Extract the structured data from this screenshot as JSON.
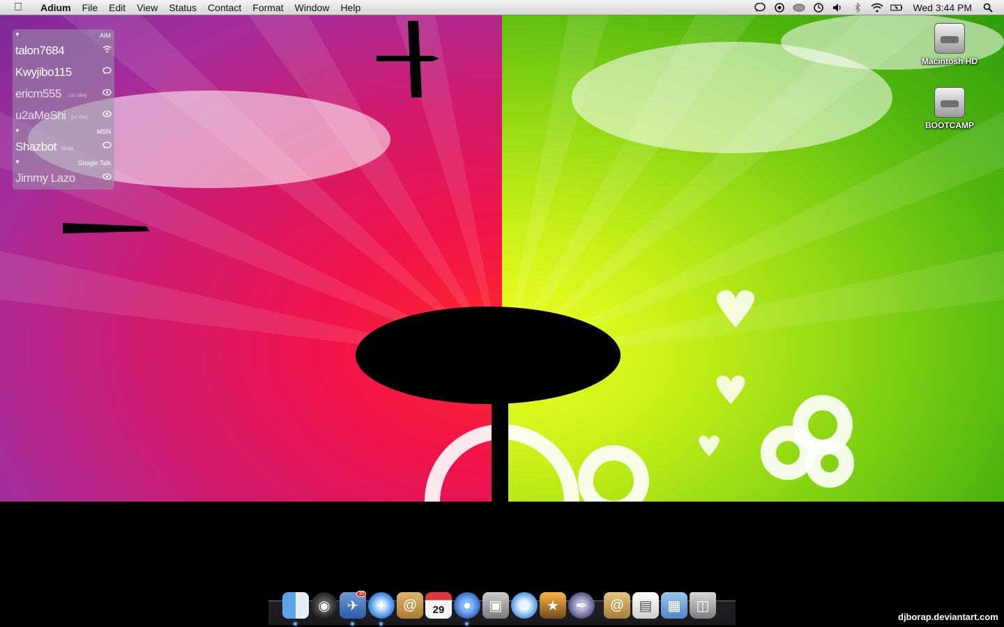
{
  "menubar": {
    "apple_icon": "apple-logo",
    "app_name": "Adium",
    "items": [
      "File",
      "Edit",
      "View",
      "Status",
      "Contact",
      "Format",
      "Window",
      "Help"
    ],
    "status_icons": [
      "adium-bubble-icon",
      "skype-icon",
      "mouse-icon",
      "time-machine-icon",
      "volume-icon",
      "bluetooth-icon",
      "wifi-icon",
      "battery-icon"
    ],
    "clock": "Wed 3:44 PM",
    "search_icon": "spotlight-icon"
  },
  "buddylist": {
    "groups": [
      {
        "name": "AIM",
        "buddies": [
          {
            "name": "talon7684",
            "status": "",
            "icon": "wifi-icon"
          },
          {
            "name": "Kwyjibo115",
            "status": "",
            "icon": "chat-bubble-icon"
          },
          {
            "name": "ericm555",
            "status": "(11s 25m)",
            "icon": "eye-icon"
          },
          {
            "name": "u2aMeShi",
            "status": "(1s 10m)",
            "icon": "eye-icon"
          }
        ]
      },
      {
        "name": "MSN",
        "buddies": [
          {
            "name": "Shazbot",
            "status": "(Busy)",
            "icon": "chat-bubble-icon"
          }
        ]
      },
      {
        "name": "Google Talk",
        "buddies": [
          {
            "name": "Jimmy Lazo",
            "status": "",
            "icon": "eye-icon"
          }
        ]
      }
    ]
  },
  "desktop": {
    "drives": [
      {
        "label": "Macintosh HD"
      },
      {
        "label": "BOOTCAMP"
      }
    ]
  },
  "dock": {
    "items": [
      {
        "name": "finder",
        "running": true
      },
      {
        "name": "dashboard",
        "running": false
      },
      {
        "name": "mail",
        "running": true,
        "badge": "39"
      },
      {
        "name": "safari",
        "running": true
      },
      {
        "name": "address-book",
        "running": false
      },
      {
        "name": "ical",
        "running": false,
        "day": "29"
      },
      {
        "name": "adium",
        "running": true
      },
      {
        "name": "preview",
        "running": false
      },
      {
        "name": "itunes",
        "running": false
      },
      {
        "name": "iphoto",
        "running": false
      },
      {
        "name": "script-editor",
        "running": false
      },
      {
        "name": "address-book-stack",
        "running": false
      },
      {
        "name": "documents-stack",
        "running": false
      },
      {
        "name": "folder-stack",
        "running": false
      },
      {
        "name": "trash",
        "running": false
      }
    ]
  },
  "watermark": "djborap.deviantart.com"
}
